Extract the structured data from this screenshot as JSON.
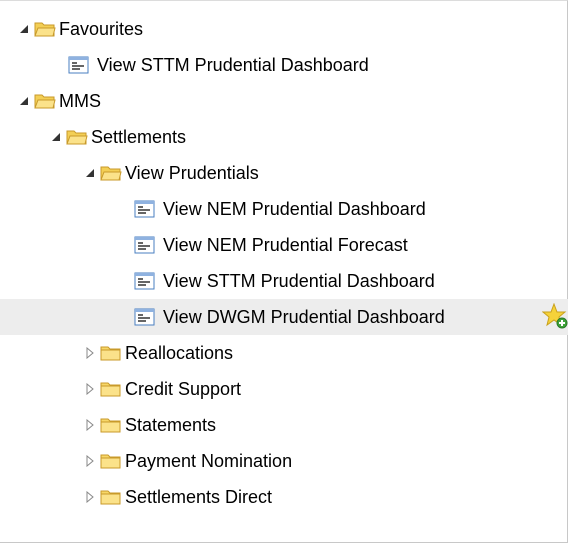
{
  "tree": {
    "favourites": {
      "label": "Favourites",
      "items": [
        {
          "label": "View STTM Prudential Dashboard"
        }
      ]
    },
    "mms": {
      "label": "MMS",
      "settlements": {
        "label": "Settlements",
        "view_prudentials": {
          "label": "View Prudentials",
          "items": [
            {
              "label": "View NEM Prudential Dashboard"
            },
            {
              "label": "View NEM Prudential Forecast"
            },
            {
              "label": "View STTM Prudential Dashboard"
            },
            {
              "label": "View DWGM Prudential Dashboard"
            }
          ]
        },
        "folders": [
          {
            "label": "Reallocations"
          },
          {
            "label": "Credit Support"
          },
          {
            "label": "Statements"
          },
          {
            "label": "Payment Nomination"
          },
          {
            "label": "Settlements Direct"
          }
        ]
      }
    }
  },
  "colors": {
    "selected_row": "#ededed",
    "folder_fill": "#f7d768",
    "folder_stroke": "#c89a2a",
    "doc_stroke": "#4a7fc1",
    "star_fill": "#f5d23a"
  }
}
